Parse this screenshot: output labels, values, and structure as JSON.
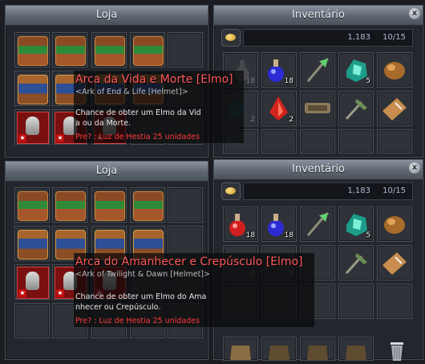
{
  "top": {
    "shop": {
      "title": "Loja"
    },
    "inventory": {
      "title": "Inventário",
      "close": "x",
      "money": "1,183",
      "capacity": "10/15"
    },
    "inventory_counts": [
      "18",
      "18",
      "",
      "5",
      "",
      "2",
      "2",
      "",
      "",
      ""
    ],
    "tooltip": {
      "name": "Arca da Vida e Morte [Elmo]",
      "english": "<Ark of End & Life [Helmet]>",
      "description": "Chance de obter um Elmo da Vid\na ou da Morte.",
      "requirement": "Pre? : Luz de Hestia 25 unidades"
    }
  },
  "bottom": {
    "shop": {
      "title": "Loja"
    },
    "inventory": {
      "title": "Inventário",
      "close": "x",
      "money": "1,183",
      "capacity": "10/15"
    },
    "inventory_counts": [
      "18",
      "18",
      "",
      "5",
      "",
      "2",
      "2",
      "",
      "",
      ""
    ],
    "tooltip": {
      "name": "Arca do Amanhecer e Crepúsculo [Elmo]",
      "english": "<Ark of Twilight & Dawn [Helmet]>",
      "description": "Chance de obter um Elmo do Ama\nnhecer ou Crepúsculo.",
      "requirement": "Pre? : Luz de Hestia 25 unidades"
    }
  }
}
